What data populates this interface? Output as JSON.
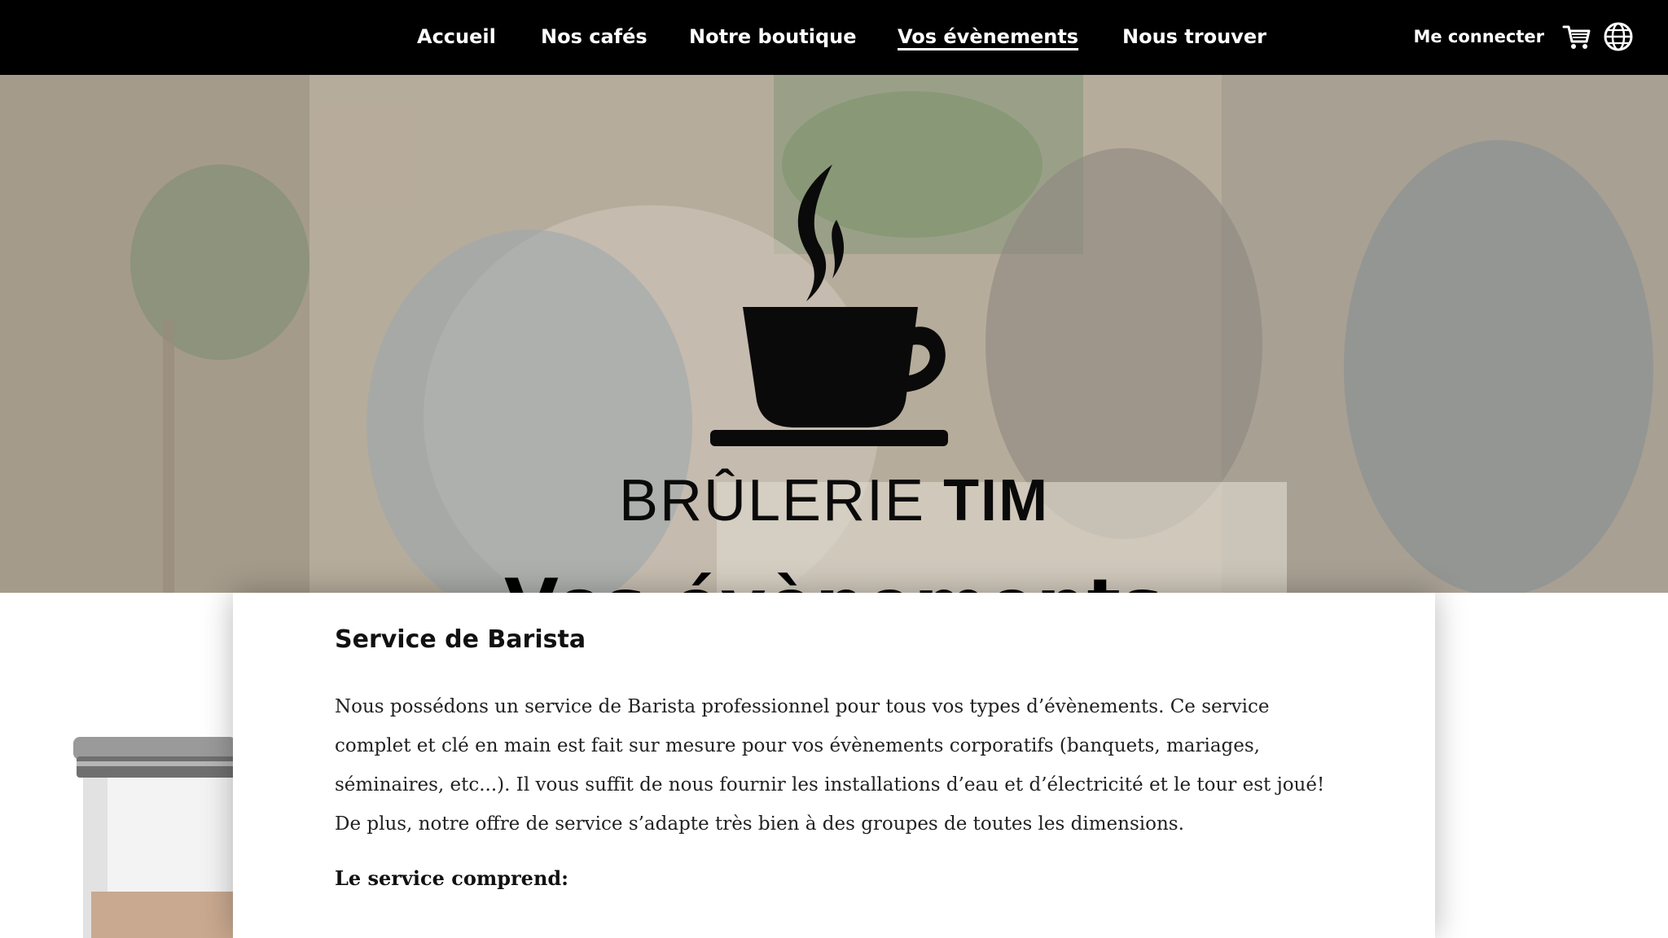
{
  "nav": {
    "items": [
      {
        "label": "Accueil",
        "active": false
      },
      {
        "label": "Nos cafés",
        "active": false
      },
      {
        "label": "Notre boutique",
        "active": false
      },
      {
        "label": "Vos évènements",
        "active": true
      },
      {
        "label": "Nous trouver",
        "active": false
      }
    ],
    "login_label": "Me connecter",
    "cart_icon": "cart-icon",
    "language_icon": "globe-icon"
  },
  "hero": {
    "brand_light": "BRÛLERIE",
    "brand_bold": "TIM",
    "title": "Vos évènements",
    "logo_icon": "coffee-cup-logo"
  },
  "content": {
    "section_title": "Service de Barista",
    "paragraph": "Nous possédons un service de Barista professionnel pour tous vos types d’évènements. Ce service complet et clé en main est fait sur mesure pour vos évènements corporatifs (banquets, mariages, séminaires, etc...). Il vous suffit de nous fournir les installations d’eau et d’électricité et le tour est joué! De plus, notre offre de service s’adapte très bien à des groupes de toutes les dimensions.",
    "subheading": "Le service comprend:"
  },
  "colors": {
    "nav_background": "#000000",
    "nav_text": "#ffffff",
    "page_background": "#ffffff",
    "text_dark": "#111111"
  }
}
